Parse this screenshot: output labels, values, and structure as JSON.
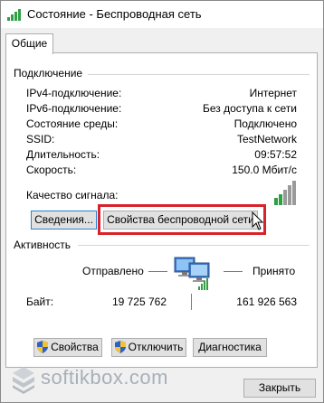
{
  "window": {
    "title": "Состояние - Беспроводная сеть"
  },
  "tabs": [
    {
      "label": "Общие"
    }
  ],
  "connection": {
    "heading": "Подключение",
    "rows": [
      {
        "label": "IPv4-подключение:",
        "value": "Интернет"
      },
      {
        "label": "IPv6-подключение:",
        "value": "Без доступа к сети"
      },
      {
        "label": "Состояние среды:",
        "value": "Подключено"
      },
      {
        "label": "SSID:",
        "value": "TestNetwork"
      },
      {
        "label": "Длительность:",
        "value": "09:57:52"
      },
      {
        "label": "Скорость:",
        "value": "150.0 Мбит/с"
      }
    ],
    "signal_label": "Качество сигнала:",
    "signal_bars": 5,
    "details_button": "Сведения...",
    "wireless_props_button": "Свойства беспроводной сети"
  },
  "activity": {
    "heading": "Активность",
    "sent_label": "Отправлено",
    "received_label": "Принято",
    "bytes_label": "Байт:",
    "sent_value": "19 725 762",
    "received_value": "161 926 563"
  },
  "actions": {
    "properties": "Свойства",
    "disable": "Отключить",
    "diagnostics": "Диагностика"
  },
  "footer": {
    "close_button": "Закрыть",
    "watermark": "softikbox.com"
  },
  "colors": {
    "highlight": "#d8232a",
    "signal_green": "#2ea043",
    "button_focus_border": "#2a7fd4"
  }
}
